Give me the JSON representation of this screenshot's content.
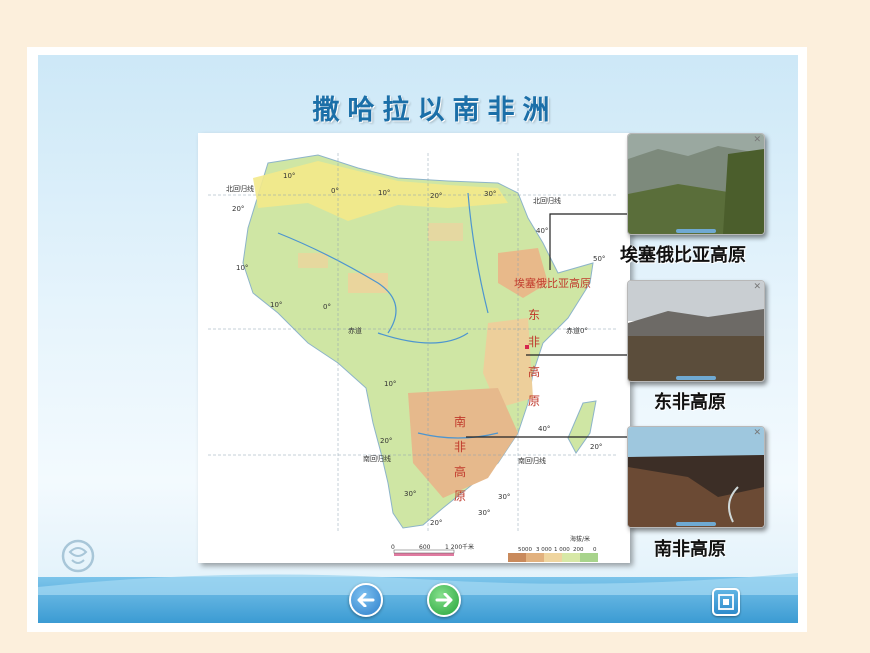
{
  "title": "撒哈拉以南非洲",
  "map": {
    "regions": {
      "ethiopia": "埃塞俄比亚高原",
      "east": [
        "东",
        "非",
        "高",
        "原"
      ],
      "south": [
        "南",
        "非",
        "高",
        "原"
      ]
    },
    "lines": {
      "tropic_north": "北回归线",
      "equator_left": "赤道",
      "equator_right": "赤道0°",
      "tropic_south": "南回归线"
    },
    "coords": [
      "10°",
      "0°",
      "10°",
      "20°",
      "30°",
      "40°",
      "50°",
      "20°",
      "10°",
      "0°",
      "10°",
      "20°",
      "30°",
      "40°",
      "10°",
      "20°",
      "30°",
      "20°",
      "30°"
    ],
    "scale": {
      "ticks": [
        "0",
        "600",
        "1 200"
      ],
      "unit": "千米"
    },
    "elevation_legend": {
      "title": "海拔/米",
      "ticks": [
        "5000",
        "3 000",
        "1 000",
        "200",
        "0"
      ]
    }
  },
  "photos": [
    {
      "label": "埃塞俄比亚高原"
    },
    {
      "label": "东非高原"
    },
    {
      "label": "南非高原"
    }
  ],
  "nav": {
    "prev_icon": "arrow-left-icon",
    "next_icon": "arrow-right-icon",
    "fullscreen_icon": "fullscreen-icon"
  },
  "colors": {
    "title": "#1b6fa8",
    "prev": "#3a8fd6",
    "next": "#36b545",
    "region_label": "#c0392b"
  }
}
